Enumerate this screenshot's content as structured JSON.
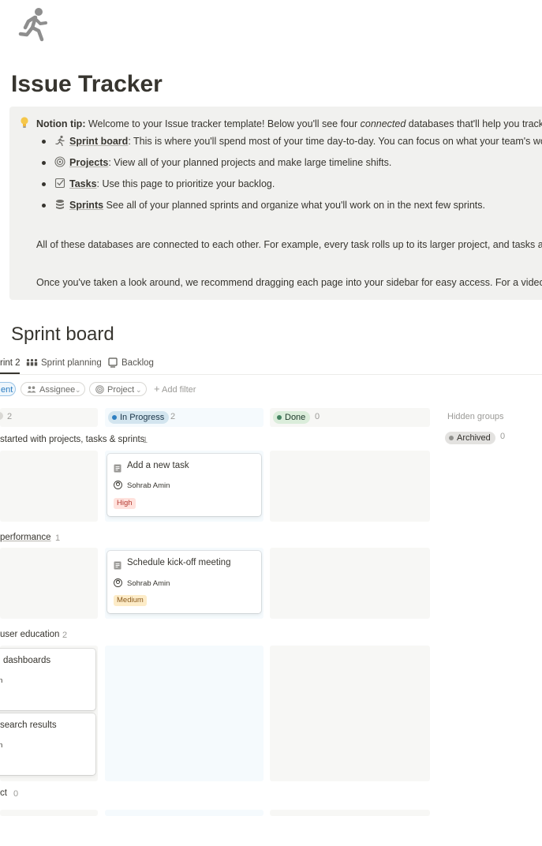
{
  "page": {
    "icon": "running-person-icon",
    "title": "Issue Tracker"
  },
  "callout": {
    "icon": "lightbulb-icon",
    "tip_label": "Notion tip:",
    "tip_text_1": " Welcome to your Issue tracker template! Below you'll see four ",
    "tip_italic": "connected",
    "tip_text_2": " databases that'll help you track your",
    "items": [
      {
        "icon": "running-person-icon",
        "link": "Sprint board",
        "text": ": This is where you'll spend most of your time day-to-day. You can focus on what your team's working"
      },
      {
        "icon": "target-icon",
        "link": "Projects",
        "text": ": View all of your planned projects and make large timeline shifts."
      },
      {
        "icon": "checkbox-icon",
        "link": "Tasks",
        "text": ": Use this page to prioritize your backlog."
      },
      {
        "icon": "database-icon",
        "link": "Sprints",
        "text": "  See all of your planned sprints and organize what you'll work on in the next few sprints."
      }
    ],
    "para_1": "All of these databases are connected to each other. For example, every task rolls up to its larger project, and tasks are also",
    "para_2": "Once you've taken a look around, we recommend dragging each page into your sidebar for easy access. For a video walkt"
  },
  "board": {
    "title": "Sprint board",
    "tabs": [
      {
        "label": "rint 2",
        "icon": "",
        "active": true
      },
      {
        "label": "Sprint planning",
        "icon": "people-icon",
        "active": false
      },
      {
        "label": "Backlog",
        "icon": "document-icon",
        "active": false
      }
    ],
    "filters": {
      "current": "ent",
      "assignee": "Assignee",
      "project": "Project",
      "add_filter": "Add filter"
    },
    "columns": {
      "first_count": "2",
      "in_progress": {
        "label": "In Progress",
        "count": "2",
        "color": "#2e7fc1"
      },
      "done": {
        "label": "Done",
        "count": "0",
        "color": "#448361"
      },
      "hidden_groups": "Hidden groups",
      "archived": {
        "label": "Archived",
        "count": "0"
      }
    },
    "rows": [
      {
        "label": "started with projects, tasks & sprints",
        "count": "1"
      },
      {
        "label": "performance",
        "count": "1"
      },
      {
        "label": "user education",
        "count": "2"
      },
      {
        "label": "ct",
        "count": "0"
      }
    ],
    "cards": [
      {
        "title": "Add a new task",
        "person": "Sohrab Amin",
        "tag": "High"
      },
      {
        "title": "Schedule kick-off meeting",
        "person": "Sohrab Amin",
        "tag": "Medium"
      },
      {
        "title": "dashboards",
        "person": "n"
      },
      {
        "title": "search results",
        "person": "n"
      }
    ]
  },
  "colors": {
    "text": "#37352f",
    "callout_bg": "#f1f1ef",
    "in_progress_lane": "#f5fafd",
    "done_lane": "#f7f7f5",
    "tag_high_bg": "#ffe2dd",
    "tag_high_fg": "#b53b32",
    "tag_medium_bg": "#fdecc8",
    "tag_medium_fg": "#8a5a1e"
  }
}
